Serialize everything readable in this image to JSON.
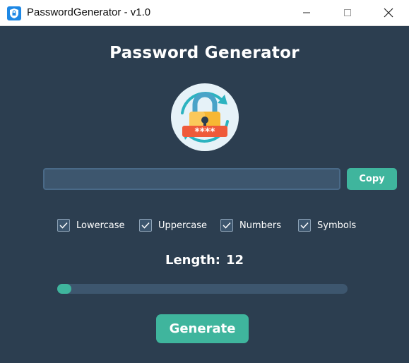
{
  "window": {
    "title": "PasswordGenerator - v1.0",
    "app_icon": "shield-lock-icon"
  },
  "main": {
    "heading": "Password Generator",
    "logo_icon": "padlock-refresh-icon",
    "logo_mask": "****",
    "password": {
      "value": "",
      "placeholder": ""
    },
    "copy_label": "Copy",
    "options": [
      {
        "label": "Lowercase",
        "checked": true
      },
      {
        "label": "Uppercase",
        "checked": true
      },
      {
        "label": "Numbers",
        "checked": true
      },
      {
        "label": "Symbols",
        "checked": true
      }
    ],
    "length_label": "Length:",
    "length_value": "12",
    "generate_label": "Generate"
  },
  "colors": {
    "background": "#2c3e50",
    "accent": "#3fb59d",
    "input_bg": "#3d566e"
  }
}
